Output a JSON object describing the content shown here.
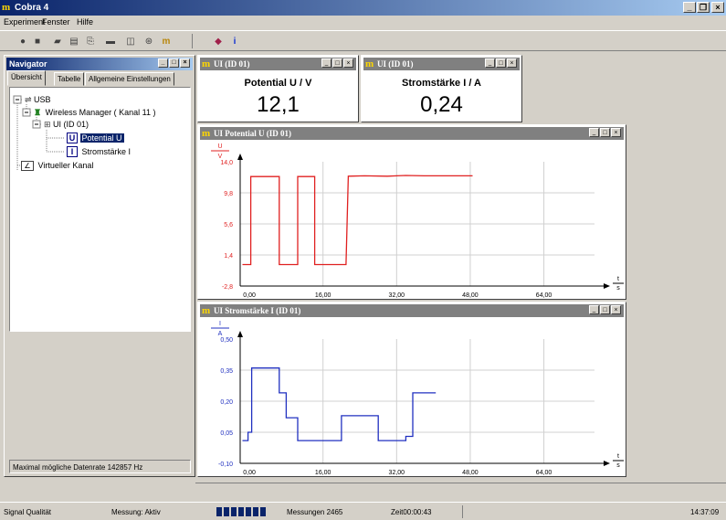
{
  "app": {
    "title": "Cobra 4"
  },
  "menu": [
    {
      "label": "Experiment",
      "key": "E"
    },
    {
      "label": "Fenster",
      "key": "F"
    },
    {
      "label": "Hilfe",
      "key": "H"
    }
  ],
  "navigator": {
    "title": "Navigator",
    "tabs": [
      "Übersicht",
      "Tabelle",
      "Allgemeine Einstellungen"
    ],
    "tree": {
      "usb": "USB",
      "wireless": "Wireless Manager ( Kanal 11 )",
      "ui": "UI (ID 01)",
      "potential": "Potential U",
      "strom": "Stromstärke I",
      "virtuell": "Virtueller Kanal"
    },
    "info": "Maximal mögliche Datenrate 142857 Hz"
  },
  "displays": [
    {
      "title": "UI (ID 01)",
      "label": "Potential U / V",
      "value": "12,1"
    },
    {
      "title": "UI (ID 01)",
      "label": "Stromstärke I / A",
      "value": "0,24"
    }
  ],
  "colors": {
    "potential": "#e02020",
    "current": "#2030c0",
    "title_active": "#0a246a",
    "logo": "#ffd700"
  },
  "chart_data": [
    {
      "type": "line",
      "title": "UI  Potential U (ID 01)",
      "ylabel_num": "U",
      "ylabel_den": "V",
      "xlabel_num": "t",
      "xlabel_den": "s",
      "xlim": [
        -2,
        75
      ],
      "ylim": [
        -2.8,
        14.0
      ],
      "xticks": [
        "0,00",
        "16,00",
        "32,00",
        "48,00",
        "64,00"
      ],
      "xtick_values": [
        0,
        16,
        32,
        48,
        64
      ],
      "yticks": [
        "14,0",
        "9,8",
        "5,6",
        "1,4",
        "-2,8"
      ],
      "ytick_values": [
        14.0,
        9.8,
        5.6,
        1.4,
        -2.8
      ],
      "grid": true,
      "series": [
        {
          "x": [
            -1.5,
            0.3,
            0.3,
            6.5,
            6.5,
            10.5,
            10.5,
            14.2,
            14.2,
            21,
            21.5,
            25,
            30,
            32,
            34,
            38,
            42,
            46,
            48.5
          ],
          "y": [
            0.1,
            0.1,
            12.0,
            12.0,
            0.1,
            0.1,
            12.0,
            12.0,
            0.1,
            0.1,
            12.05,
            12.1,
            12.05,
            12.1,
            12.15,
            12.1,
            12.1,
            12.1,
            12.1
          ]
        }
      ]
    },
    {
      "type": "line",
      "title": "UI  Stromstärke I (ID 01)",
      "ylabel_num": "I",
      "ylabel_den": "A",
      "xlabel_num": "t",
      "xlabel_den": "s",
      "xlim": [
        -2,
        75
      ],
      "ylim": [
        -0.1,
        0.5
      ],
      "xticks": [
        "0,00",
        "16,00",
        "32,00",
        "48,00",
        "64,00"
      ],
      "xtick_values": [
        0,
        16,
        32,
        48,
        64
      ],
      "yticks": [
        "0,50",
        "0,35",
        "0,20",
        "0,05",
        "-0,10"
      ],
      "ytick_values": [
        0.5,
        0.35,
        0.2,
        0.05,
        -0.1
      ],
      "grid": true,
      "series": [
        {
          "x": [
            -1.5,
            -0.3,
            -0.3,
            0.5,
            0.5,
            6.5,
            6.5,
            8.0,
            8.0,
            10.5,
            10.5,
            14.5,
            20,
            20,
            28,
            28,
            30,
            34,
            34,
            35.5,
            35.5,
            40.5
          ],
          "y": [
            0.01,
            0.01,
            0.05,
            0.05,
            0.36,
            0.36,
            0.24,
            0.24,
            0.12,
            0.12,
            0.01,
            0.01,
            0.01,
            0.13,
            0.13,
            0.01,
            0.01,
            0.01,
            0.03,
            0.03,
            0.24,
            0.24
          ]
        }
      ]
    }
  ],
  "statusbar": {
    "signal": "Signal Qualität",
    "messung": "Messung: Aktiv",
    "count": "Messungen 2465",
    "zeit": "Zeit00:00:43",
    "clock": "14:37:09"
  }
}
